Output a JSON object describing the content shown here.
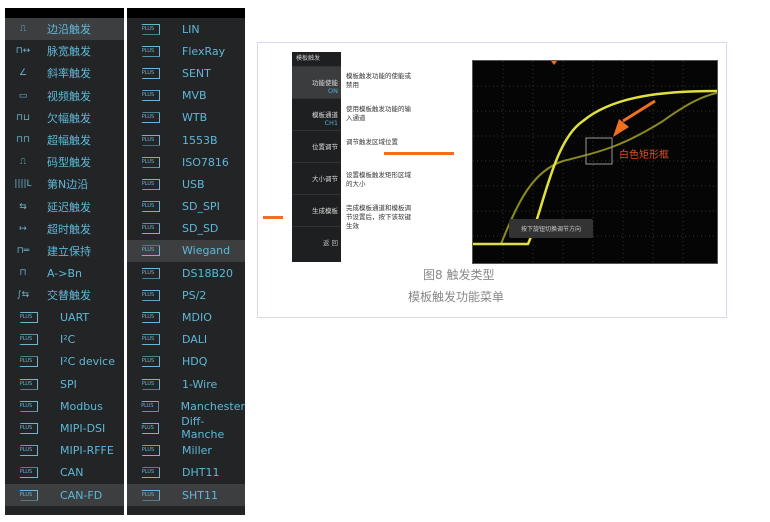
{
  "trigger_types": [
    {
      "icon": "⎍",
      "label": "边沿触发",
      "selected": true
    },
    {
      "icon": "⊓↔",
      "label": "脉宽触发"
    },
    {
      "icon": "∠",
      "label": "斜率触发"
    },
    {
      "icon": "▭",
      "label": "视频触发"
    },
    {
      "icon": "⊓⊔",
      "label": "欠幅触发"
    },
    {
      "icon": "⊓⊓",
      "label": "超幅触发"
    },
    {
      "icon": "⎍",
      "label": "码型触发"
    },
    {
      "icon": "||||L",
      "label": "第N边沿"
    },
    {
      "icon": "⇆",
      "label": "延迟触发"
    },
    {
      "icon": "↦",
      "label": "超时触发"
    },
    {
      "icon": "⊓═",
      "label": "建立保持"
    },
    {
      "icon": "⊓",
      "label": "A->Bn"
    },
    {
      "icon": "∫⇆",
      "label": "交替触发"
    },
    {
      "plus": "PLUS",
      "label": "UART"
    },
    {
      "plus": "PLUS",
      "label": "I²C"
    },
    {
      "plus": "PLUS",
      "label": "I²C device"
    },
    {
      "plus": "PLUS",
      "label": "SPI"
    },
    {
      "plus": "PLUS",
      "label": "Modbus"
    },
    {
      "plus": "PLUS",
      "label": "MIPI-DSI"
    },
    {
      "plus": "PLUS",
      "label": "MIPI-RFFE"
    },
    {
      "plus": "PLUS",
      "label": "CAN"
    },
    {
      "plus": "PLUS",
      "label": "CAN-FD",
      "selected": true
    }
  ],
  "protocols": [
    {
      "plus": "PLUS",
      "label": "LIN"
    },
    {
      "plus": "PLUS",
      "label": "FlexRay"
    },
    {
      "plus": "PLUS",
      "label": "SENT"
    },
    {
      "plus": "PLUS",
      "label": "MVB"
    },
    {
      "plus": "PLUS",
      "label": "WTB"
    },
    {
      "plus": "PLUS",
      "label": "1553B"
    },
    {
      "plus": "PLUS",
      "label": "ISO7816"
    },
    {
      "plus": "PLUS",
      "label": "USB"
    },
    {
      "plus": "PLUS",
      "label": "SD_SPI"
    },
    {
      "plus": "PLUS",
      "label": "SD_SD"
    },
    {
      "plus": "PLUS",
      "label": "Wiegand",
      "selected": true
    },
    {
      "plus": "PLUS",
      "label": "DS18B20"
    },
    {
      "plus": "PLUS",
      "label": "PS/2"
    },
    {
      "plus": "PLUS",
      "label": "MDIO"
    },
    {
      "plus": "PLUS",
      "label": "DALI"
    },
    {
      "plus": "PLUS",
      "label": "HDQ"
    },
    {
      "plus": "PLUS",
      "label": "1-Wire"
    },
    {
      "plus": "PLUS",
      "label": "Manchester"
    },
    {
      "plus": "PLUS",
      "label": "Diff-Manche"
    },
    {
      "plus": "PLUS",
      "label": "Miller"
    },
    {
      "plus": "PLUS",
      "label": "DHT11"
    },
    {
      "plus": "PLUS",
      "label": "SHT11",
      "selected": true
    }
  ],
  "template_menu": {
    "title": "模板触发",
    "items": [
      {
        "label": "功能使能",
        "value": "ON",
        "desc": "模板触发功能的使能或禁用"
      },
      {
        "label": "模板通道",
        "value": "CH1",
        "desc": "使用模板触发功能的输入通道"
      },
      {
        "label": "位置调节",
        "desc": "调节触发区域位置"
      },
      {
        "label": "大小调节",
        "desc": "设置模板触发矩形区域的大小"
      },
      {
        "label": "生成模板",
        "desc": "完成模板通道和模板调节设置后，按下该软键生效"
      }
    ],
    "back": "返 回"
  },
  "scope": {
    "annotation": "白色矩形框",
    "hint": "按下旋钮切换调节方向"
  },
  "caption": {
    "line1": "图8 触发类型",
    "line2": "模板触发功能菜单"
  },
  "colors": {
    "accent": "#f07020",
    "trace": "#e0e040",
    "text": "#5fb8d8"
  }
}
